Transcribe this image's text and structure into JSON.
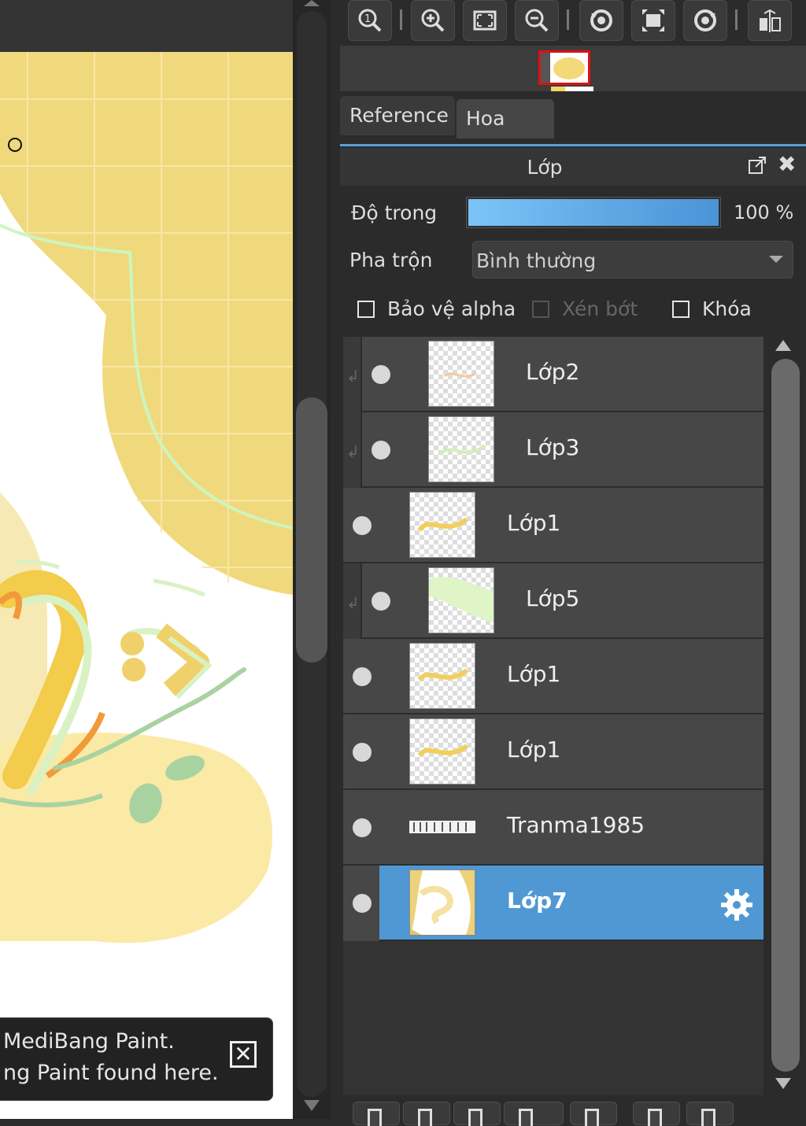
{
  "toast": {
    "line1": "MediBang Paint.",
    "line2": "ng Paint found here."
  },
  "toolbar": {
    "icons": [
      "zoom-actual-icon",
      "zoom-in-icon",
      "fit-screen-icon",
      "zoom-out-icon",
      "rotate-left-icon",
      "fullscreen-icon",
      "rotate-right-icon",
      "flip-icon"
    ]
  },
  "tabs": {
    "reference": "Reference",
    "navigator": "Hoa tiêu"
  },
  "layer_panel": {
    "title": "Lớp",
    "opacity_label": "Độ trong",
    "opacity_value": "100 %",
    "opacity_fraction": 1.0,
    "blend_label": "Pha trộn",
    "blend_value": "Bình thường",
    "protect_alpha_label": "Bảo vệ alpha",
    "clip_label": "Xén bớt",
    "lock_label": "Khóa",
    "layers": [
      {
        "name": "Lớp2",
        "clipped": true,
        "selected": false
      },
      {
        "name": "Lớp3",
        "clipped": true,
        "selected": false
      },
      {
        "name": "Lớp1",
        "clipped": false,
        "selected": false
      },
      {
        "name": "Lớp5",
        "clipped": true,
        "selected": false
      },
      {
        "name": "Lớp1",
        "clipped": false,
        "selected": false
      },
      {
        "name": "Lớp1",
        "clipped": false,
        "selected": false
      },
      {
        "name": "Tranma1985",
        "clipped": false,
        "selected": false
      },
      {
        "name": "Lớp7",
        "clipped": false,
        "selected": true
      }
    ]
  },
  "colors": {
    "accent": "#4f98d4",
    "canvas_yellow": "#f0d97c",
    "grid_line": "#f6e6a6",
    "swoosh_green": "#cdf5c0"
  }
}
